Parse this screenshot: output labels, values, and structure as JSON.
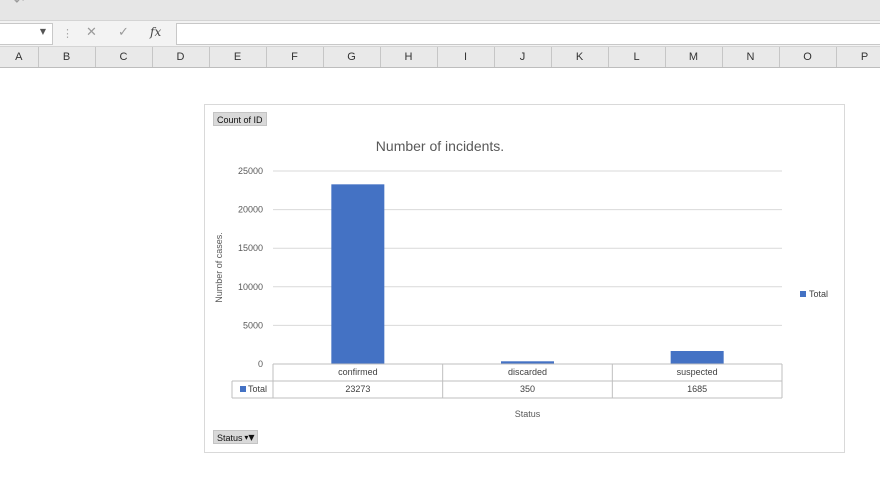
{
  "formula_bar": {
    "cancel_icon": "close-icon",
    "enter_icon": "check-icon",
    "fx_label": "fx",
    "formula": ""
  },
  "columns": [
    "A",
    "B",
    "C",
    "D",
    "E",
    "F",
    "G",
    "H",
    "I",
    "J",
    "K",
    "L",
    "M",
    "N",
    "O",
    "P"
  ],
  "pivot": {
    "values_button": "Count of ID",
    "field_button": "Status"
  },
  "colors": {
    "bar": "#4472c4",
    "ribbon": "#e6e6e6",
    "header": "#e9e9e9"
  },
  "chart_data": {
    "type": "bar",
    "title": "Number of incidents.",
    "xlabel": "Status",
    "ylabel": "Number of cases.",
    "categories": [
      "confirmed",
      "discarded",
      "suspected"
    ],
    "series": [
      {
        "name": "Total",
        "values": [
          23273,
          350,
          1685
        ]
      }
    ],
    "ylim": [
      0,
      25000
    ],
    "yticks": [
      0,
      5000,
      10000,
      15000,
      20000,
      25000
    ],
    "grid": true,
    "legend": "right",
    "data_table": true
  }
}
